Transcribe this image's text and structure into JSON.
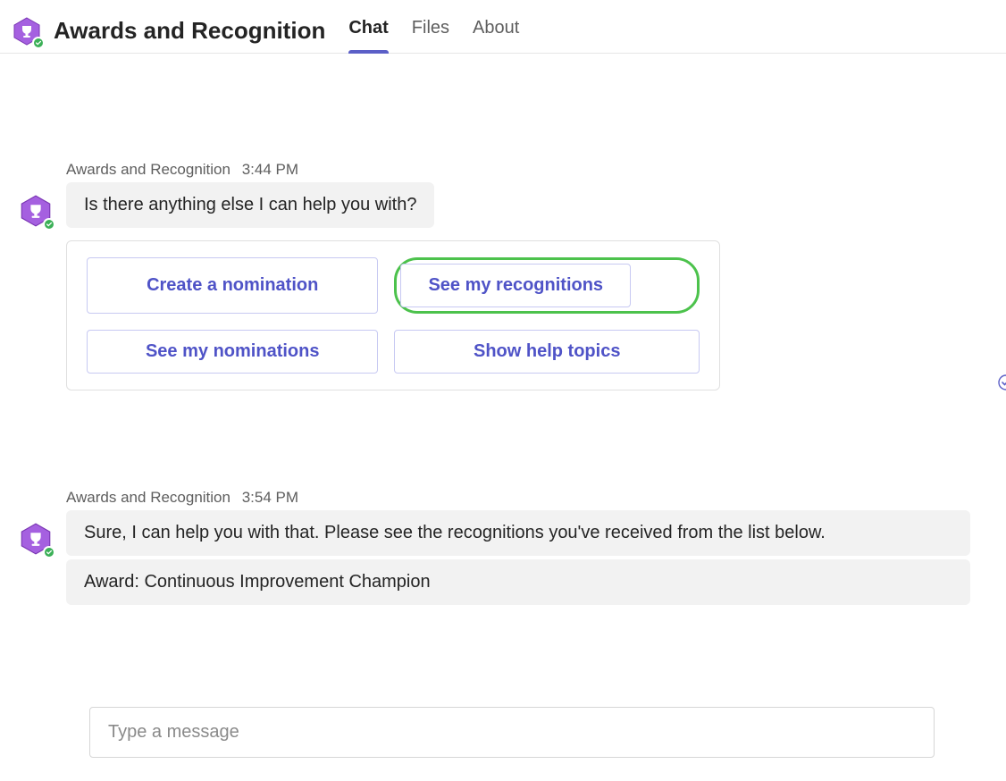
{
  "header": {
    "title": "Awards and Recognition",
    "tabs": [
      {
        "label": "Chat",
        "active": true
      },
      {
        "label": "Files",
        "active": false
      },
      {
        "label": "About",
        "active": false
      }
    ]
  },
  "messages": [
    {
      "sender": "Awards and Recognition",
      "time": "3:44 PM",
      "text": "Is there anything else I can help you with?",
      "actions": [
        {
          "label": "Create a nomination",
          "highlighted": false
        },
        {
          "label": "See my recognitions",
          "highlighted": true
        },
        {
          "label": "See my nominations",
          "highlighted": false
        },
        {
          "label": "Show help topics",
          "highlighted": false
        }
      ]
    },
    {
      "sender": "Awards and Recognition",
      "time": "3:54 PM",
      "text_line1": "Sure, I can help you with that. Please see the recognitions you've received from the list below.",
      "text_line2": "Award: Continuous Improvement Champion"
    }
  ],
  "compose": {
    "placeholder": "Type a message"
  },
  "icons": {
    "app_avatar": "trophy-hexagon",
    "presence": "available-check",
    "read_receipt": "seen-check-circle"
  },
  "colors": {
    "accent": "#5b5fc7",
    "highlight_ring": "#4cc24c",
    "avatar_purple": "#8b3fbf"
  }
}
